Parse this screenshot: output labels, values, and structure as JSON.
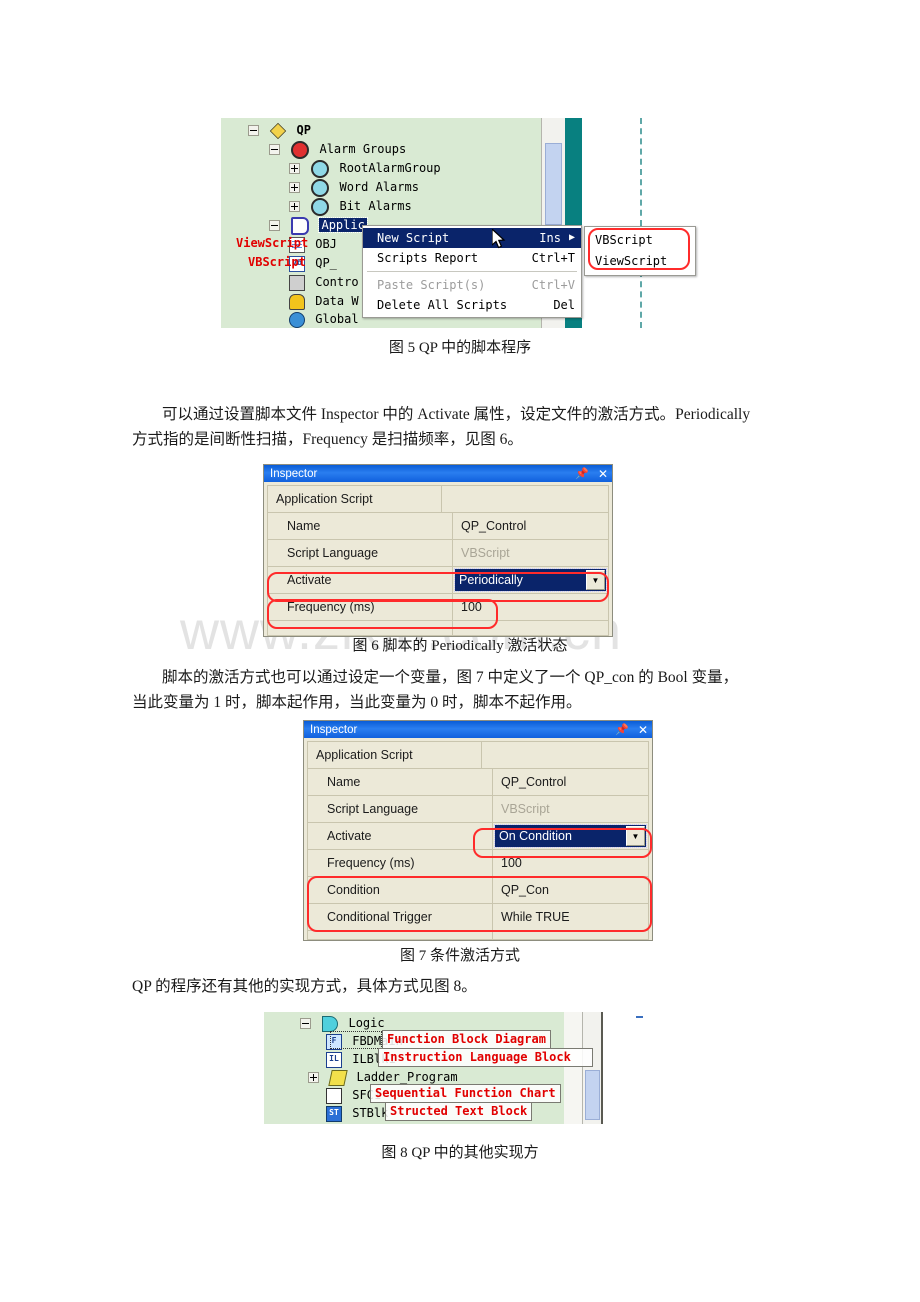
{
  "document": {
    "watermark": "www.zixin.com.cn",
    "paragraphs": [
      {
        "id": "p1",
        "lines": [
          "可以通过设置脚本文件 Inspector 中的 Activate 属性，设定文件的激活方式。Periodically",
          "方式指的是间断性扫描，Frequency 是扫描频率，见图 6。"
        ]
      },
      {
        "id": "p2",
        "lines": [
          "脚本的激活方式也可以通过设定一个变量，图 7 中定义了一个 QP_con 的 Bool 变量，",
          "当此变量为 1 时，脚本起作用，当此变量为 0 时，脚本不起作用。"
        ]
      },
      {
        "id": "p3",
        "lines": [
          "QP 的程序还有其他的实现方式，具体方式见图 8。"
        ]
      }
    ],
    "captions": {
      "fig5": "图 5 QP 中的脚本程序",
      "fig6": "图 6  脚本的 Periodically 激活状态",
      "fig7": "图 7  条件激活方式",
      "fig8": "图 8 QP 中的其他实现方"
    }
  },
  "figure5": {
    "tree": [
      {
        "label": "QP",
        "icon": "diamond-icon",
        "toggle": "minus",
        "indent": 0,
        "bold": true
      },
      {
        "label": "Alarm Groups",
        "icon": "alarm-clock-red-icon",
        "toggle": "minus",
        "indent": 1
      },
      {
        "label": "RootAlarmGroup",
        "icon": "alarm-clock-cyan-icon",
        "toggle": "plus",
        "indent": 2
      },
      {
        "label": "Word Alarms",
        "icon": "alarm-clock-cyan-icon",
        "toggle": "plus",
        "indent": 2
      },
      {
        "label": "Bit Alarms",
        "icon": "alarm-clock-cyan-icon",
        "toggle": "plus",
        "indent": 2
      },
      {
        "label": "Applic",
        "icon": "book-icon",
        "toggle": "minus",
        "indent": 1,
        "selected": true
      },
      {
        "label": "OBJ",
        "icon": "document-icon",
        "toggle": "none",
        "indent": 2
      },
      {
        "label": "QP_",
        "icon": "vbscript-icon",
        "toggle": "none",
        "indent": 2
      },
      {
        "label": "Contro",
        "icon": "computer-icon",
        "toggle": "none",
        "indent": 2
      },
      {
        "label": "Data W",
        "icon": "hardhat-icon",
        "toggle": "none",
        "indent": 2
      },
      {
        "label": "Global",
        "icon": "globe-icon",
        "toggle": "none",
        "indent": 2
      }
    ],
    "annotations": [
      {
        "text": "ViewScript",
        "color": "#e10000"
      },
      {
        "text": "VBScript",
        "color": "#e10000"
      }
    ],
    "context_menu": [
      {
        "label": "New Script",
        "accel": "Ins",
        "submenu": true,
        "selected": true,
        "disabled": false
      },
      {
        "label": "Scripts Report",
        "accel": "Ctrl+T",
        "submenu": false,
        "selected": false,
        "disabled": false
      },
      {
        "separator": true
      },
      {
        "label": "Paste Script(s)",
        "accel": "Ctrl+V",
        "submenu": false,
        "selected": false,
        "disabled": true
      },
      {
        "label": "Delete All Scripts",
        "accel": "Del",
        "submenu": false,
        "selected": false,
        "disabled": false
      }
    ],
    "submenu": [
      {
        "label": "VBScript"
      },
      {
        "label": "ViewScript"
      }
    ]
  },
  "figure6": {
    "title": "Inspector",
    "pin_icon": "pin-icon",
    "close_icon": "close-icon",
    "rows": [
      {
        "label": "Application Script",
        "value": "",
        "indent": false,
        "dim": false,
        "combo": false,
        "highlight": false
      },
      {
        "label": "Name",
        "value": "QP_Control",
        "indent": true,
        "dim": false,
        "combo": false,
        "highlight": false
      },
      {
        "label": "Script Language",
        "value": "VBScript",
        "indent": true,
        "dim": true,
        "combo": false,
        "highlight": false
      },
      {
        "label": "Activate",
        "value": "Periodically",
        "indent": true,
        "dim": false,
        "combo": true,
        "highlight": true
      },
      {
        "label": "Frequency (ms)",
        "value": "100",
        "indent": true,
        "dim": false,
        "combo": false,
        "highlight": true
      }
    ]
  },
  "figure7": {
    "title": "Inspector",
    "pin_icon": "pin-icon",
    "close_icon": "close-icon",
    "rows": [
      {
        "label": "Application Script",
        "value": "",
        "indent": false,
        "dim": false,
        "combo": false
      },
      {
        "label": "Name",
        "value": "QP_Control",
        "indent": true,
        "dim": false,
        "combo": false
      },
      {
        "label": "Script Language",
        "value": "VBScript",
        "indent": true,
        "dim": true,
        "combo": false
      },
      {
        "label": "Activate",
        "value": "On Condition",
        "indent": true,
        "dim": false,
        "combo": true
      },
      {
        "label": "Frequency (ms)",
        "value": "100",
        "indent": true,
        "dim": false,
        "combo": false
      },
      {
        "label": "Condition",
        "value": "QP_Con",
        "indent": true,
        "dim": false,
        "combo": false
      },
      {
        "label": "Conditional Trigger",
        "value": "While TRUE",
        "indent": true,
        "dim": false,
        "combo": false
      }
    ]
  },
  "figure8": {
    "tree": [
      {
        "label": "Logic",
        "icon": "logic-icon",
        "toggle": "minus",
        "indent": 0,
        "annotation": ""
      },
      {
        "label": "FBDMain",
        "icon": "fbd-icon",
        "toggle": "none",
        "indent": 1,
        "annotation": "Function Block Diagram"
      },
      {
        "label": "ILBlk1",
        "icon": "il-icon",
        "toggle": "none",
        "indent": 1,
        "annotation": "Instruction Language Block"
      },
      {
        "label": "Ladder_Program",
        "icon": "ladder-icon",
        "toggle": "plus",
        "indent": 1,
        "annotation": ""
      },
      {
        "label": "SFC1",
        "icon": "sfc-icon",
        "toggle": "none",
        "indent": 1,
        "annotation": "Sequential Function Chart"
      },
      {
        "label": "STBlk",
        "icon": "st-icon",
        "toggle": "none",
        "indent": 1,
        "annotation": "Structed Text Block"
      }
    ]
  }
}
